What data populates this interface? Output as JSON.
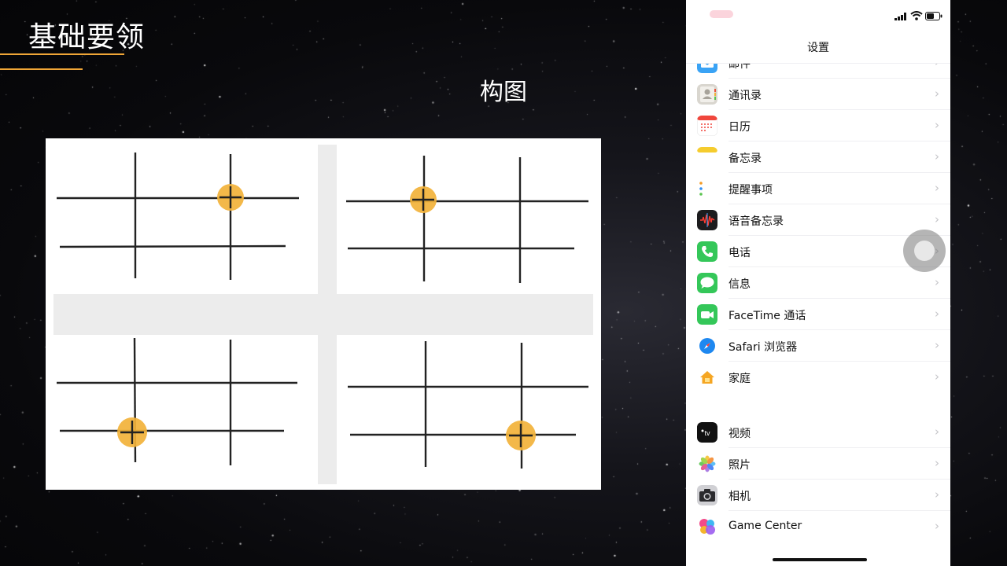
{
  "slide": {
    "title": "基础要领",
    "subtitle": "构图",
    "accent_color": "#f0a637"
  },
  "phone": {
    "nav_title": "设置",
    "group1": [
      {
        "label": "邮件",
        "icon": "mail-icon"
      },
      {
        "label": "通讯录",
        "icon": "contacts-icon"
      },
      {
        "label": "日历",
        "icon": "calendar-icon"
      },
      {
        "label": "备忘录",
        "icon": "notes-icon"
      },
      {
        "label": "提醒事项",
        "icon": "reminders-icon"
      },
      {
        "label": "语音备忘录",
        "icon": "voice-memos-icon"
      },
      {
        "label": "电话",
        "icon": "phone-icon"
      },
      {
        "label": "信息",
        "icon": "messages-icon"
      },
      {
        "label": "FaceTime 通话",
        "icon": "facetime-icon"
      },
      {
        "label": "Safari 浏览器",
        "icon": "safari-icon"
      },
      {
        "label": "家庭",
        "icon": "home-icon"
      }
    ],
    "group2": [
      {
        "label": "视频",
        "icon": "tv-icon"
      },
      {
        "label": "照片",
        "icon": "photos-icon"
      },
      {
        "label": "相机",
        "icon": "camera-icon"
      },
      {
        "label": "Game Center",
        "icon": "game-center-icon"
      }
    ],
    "chevron": "›"
  },
  "figure": {
    "focus_color": "#f2b23a",
    "line_color": "#222222",
    "panel_bg": "#ffffff",
    "gutter_bg": "#ececec"
  }
}
